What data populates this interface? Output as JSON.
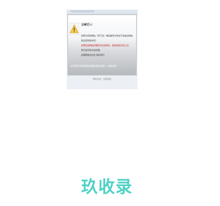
{
  "dialog": {
    "heading": "温馨提示：",
    "lines": [
      "您所访问的网站（有不良）域名被列为非法不良信息网站",
      "建议您暂停访问：",
      "如果您是网站管理员请点击联系，提供域名实名认证，",
      "我们会尽快为您处理，",
      "如需帮助请点击 联系我们"
    ],
    "link_text": "联系我们",
    "bottom_note": "如有疑问请咨询网站管理员或相关部门，谢谢合作！",
    "footer": "域名状态：问题域名"
  },
  "brand": {
    "text": "玖收录"
  },
  "colors": {
    "brand": "#4fd1c5",
    "warning": "#f2c94c"
  }
}
